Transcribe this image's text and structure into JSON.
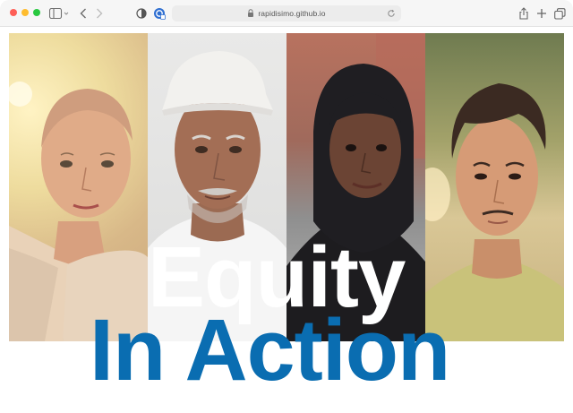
{
  "browser": {
    "url": "rapidisimo.github.io",
    "icons": {
      "sidebar": "sidebar-icon",
      "back": "chevron-left-icon",
      "forward": "chevron-right-icon",
      "privacy": "shield-icon",
      "extension": "extension-icon",
      "lock": "lock-icon",
      "reload": "reload-icon",
      "share": "share-icon",
      "new_tab": "plus-icon",
      "tabs": "tabs-overview-icon"
    }
  },
  "hero": {
    "title_line1": "Equity",
    "title_line2": "In Action",
    "colors": {
      "line1": "#ffffff",
      "line2": "#0a6db1"
    }
  }
}
